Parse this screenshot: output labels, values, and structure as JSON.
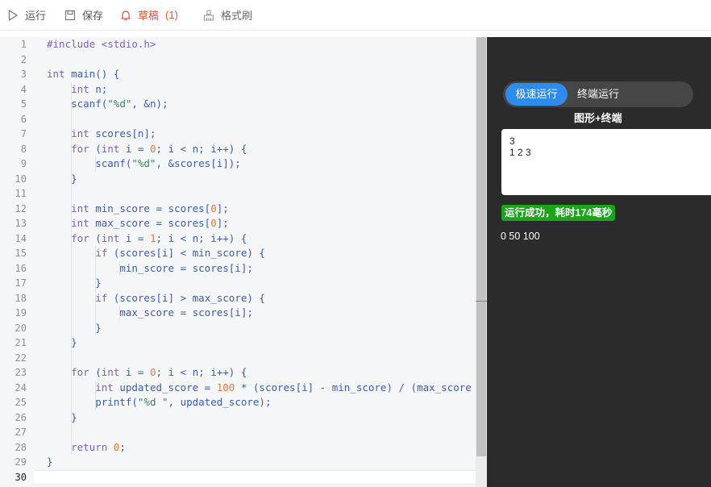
{
  "toolbar": {
    "run_label": "运行",
    "save_label": "保存",
    "draft_label": "草稿",
    "draft_count": "(1)",
    "format_label": "格式刷"
  },
  "editor": {
    "active_line": 30,
    "lines": [
      [
        [
          "#include <stdio.h>",
          "#7b5ec2"
        ]
      ],
      [],
      [
        [
          "int",
          "#7b5ec2"
        ],
        [
          " main() {",
          "#3b5bb5"
        ]
      ],
      [
        [
          "    ",
          "#3b5bb5"
        ],
        [
          "int",
          "#7b5ec2"
        ],
        [
          " n;",
          "#3b5bb5"
        ]
      ],
      [
        [
          "    scanf(",
          "#3b5bb5"
        ],
        [
          "\"%d\"",
          "#2e8b57"
        ],
        [
          ", &n);",
          "#3b5bb5"
        ]
      ],
      [],
      [
        [
          "    ",
          "#3b5bb5"
        ],
        [
          "int",
          "#7b5ec2"
        ],
        [
          " scores[n];",
          "#3b5bb5"
        ]
      ],
      [
        [
          "    ",
          "#3b5bb5"
        ],
        [
          "for",
          "#7b5ec2"
        ],
        [
          " (",
          "#3b5bb5"
        ],
        [
          "int",
          "#7b5ec2"
        ],
        [
          " i = ",
          "#3b5bb5"
        ],
        [
          "0",
          "#e8773a"
        ],
        [
          "; i < n; i++) {",
          "#3b5bb5"
        ]
      ],
      [
        [
          "        scanf(",
          "#3b5bb5"
        ],
        [
          "\"%d\"",
          "#2e8b57"
        ],
        [
          ", &scores[i]);",
          "#3b5bb5"
        ]
      ],
      [
        [
          "    }",
          "#3b5bb5"
        ]
      ],
      [],
      [
        [
          "    ",
          "#3b5bb5"
        ],
        [
          "int",
          "#7b5ec2"
        ],
        [
          " min_score = scores[",
          "#3b5bb5"
        ],
        [
          "0",
          "#e8773a"
        ],
        [
          "];",
          "#3b5bb5"
        ]
      ],
      [
        [
          "    ",
          "#3b5bb5"
        ],
        [
          "int",
          "#7b5ec2"
        ],
        [
          " max_score = scores[",
          "#3b5bb5"
        ],
        [
          "0",
          "#e8773a"
        ],
        [
          "];",
          "#3b5bb5"
        ]
      ],
      [
        [
          "    ",
          "#3b5bb5"
        ],
        [
          "for",
          "#7b5ec2"
        ],
        [
          " (",
          "#3b5bb5"
        ],
        [
          "int",
          "#7b5ec2"
        ],
        [
          " i = ",
          "#3b5bb5"
        ],
        [
          "1",
          "#e8773a"
        ],
        [
          "; i < n; i++) {",
          "#3b5bb5"
        ]
      ],
      [
        [
          "        ",
          "#3b5bb5"
        ],
        [
          "if",
          "#7b5ec2"
        ],
        [
          " (scores[i] < min_score) {",
          "#3b5bb5"
        ]
      ],
      [
        [
          "            min_score = scores[i];",
          "#3b5bb5"
        ]
      ],
      [
        [
          "        }",
          "#3b5bb5"
        ]
      ],
      [
        [
          "        ",
          "#3b5bb5"
        ],
        [
          "if",
          "#7b5ec2"
        ],
        [
          " (scores[i] > max_score) {",
          "#3b5bb5"
        ]
      ],
      [
        [
          "            max_score = scores[i];",
          "#3b5bb5"
        ]
      ],
      [
        [
          "        }",
          "#3b5bb5"
        ]
      ],
      [
        [
          "    }",
          "#3b5bb5"
        ]
      ],
      [],
      [
        [
          "    ",
          "#3b5bb5"
        ],
        [
          "for",
          "#7b5ec2"
        ],
        [
          " (",
          "#3b5bb5"
        ],
        [
          "int",
          "#7b5ec2"
        ],
        [
          " i = ",
          "#3b5bb5"
        ],
        [
          "0",
          "#e8773a"
        ],
        [
          "; i < n; i++) {",
          "#3b5bb5"
        ]
      ],
      [
        [
          "        ",
          "#3b5bb5"
        ],
        [
          "int",
          "#7b5ec2"
        ],
        [
          " updated_score = ",
          "#3b5bb5"
        ],
        [
          "100",
          "#e8773a"
        ],
        [
          " * (scores[i] - min_score) / (max_score - ",
          "#3b5bb5"
        ]
      ],
      [
        [
          "        printf(",
          "#3b5bb5"
        ],
        [
          "\"%d \"",
          "#2e8b57"
        ],
        [
          ", updated_score);",
          "#3b5bb5"
        ]
      ],
      [
        [
          "    }",
          "#3b5bb5"
        ]
      ],
      [],
      [
        [
          "    ",
          "#3b5bb5"
        ],
        [
          "return",
          "#7b5ec2"
        ],
        [
          " ",
          "#3b5bb5"
        ],
        [
          "0",
          "#e8773a"
        ],
        [
          ";",
          "#3b5bb5"
        ]
      ],
      [
        [
          "}",
          "#3b5bb5"
        ]
      ],
      []
    ]
  },
  "panel": {
    "mode_fast": "极速运行",
    "mode_terminal": "终端运行",
    "mode_graphic": "图形+终端",
    "stdin_lines": [
      "3",
      "1 2 3"
    ],
    "status": "运行成功，耗时174毫秒",
    "output": "0 50 100"
  },
  "colors": {
    "accent": "#2d8cf0",
    "success": "#19a419",
    "draft": "#e0573f"
  },
  "icons": {
    "run": "play-icon",
    "save": "save-icon",
    "draft": "bell-icon",
    "format": "format-brush-icon"
  }
}
